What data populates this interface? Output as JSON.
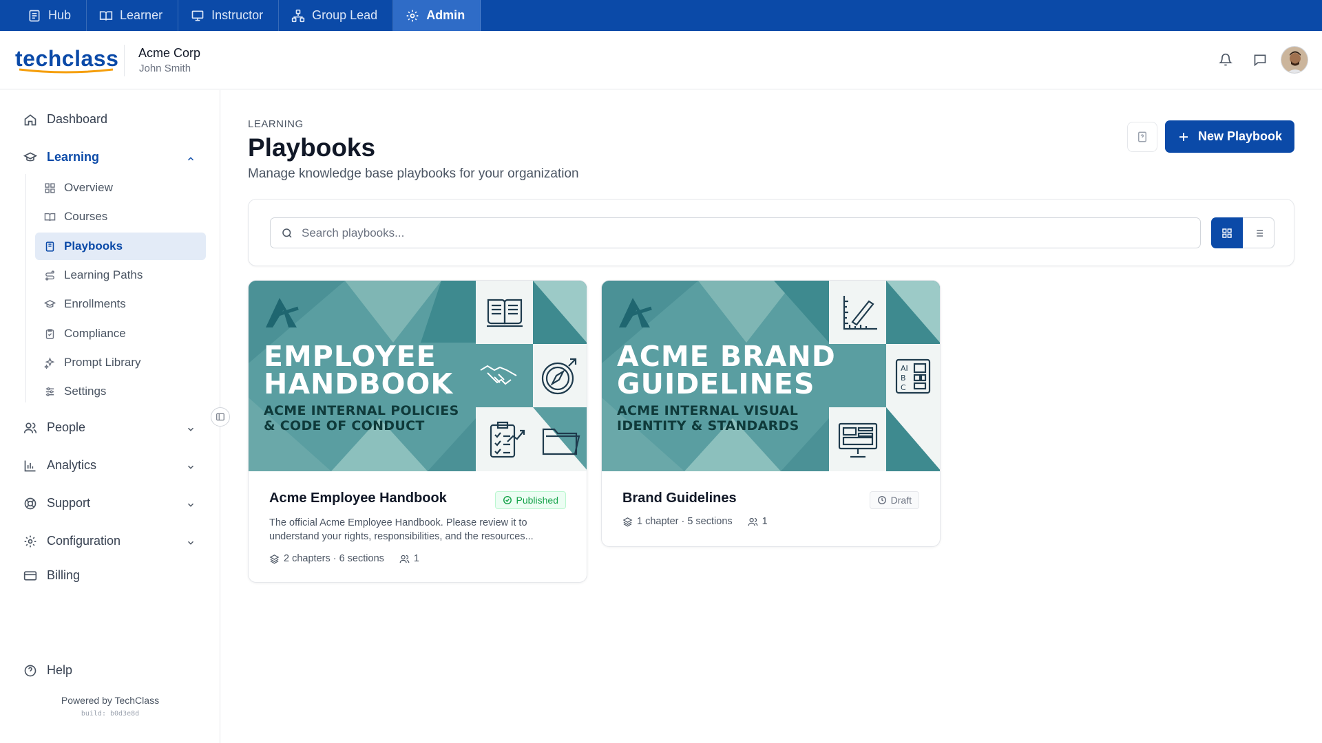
{
  "topnav": [
    {
      "label": "Hub",
      "icon": "hub-icon"
    },
    {
      "label": "Learner",
      "icon": "book-open-icon"
    },
    {
      "label": "Instructor",
      "icon": "presentation-icon"
    },
    {
      "label": "Group Lead",
      "icon": "network-icon"
    },
    {
      "label": "Admin",
      "icon": "gear-icon",
      "active": true
    }
  ],
  "header": {
    "logo": "techclass",
    "org": "Acme Corp",
    "user": "John Smith"
  },
  "sidebar": {
    "dashboard": "Dashboard",
    "learning": "Learning",
    "sub": [
      "Overview",
      "Courses",
      "Playbooks",
      "Learning Paths",
      "Enrollments",
      "Compliance",
      "Prompt Library",
      "Settings"
    ],
    "people": "People",
    "analytics": "Analytics",
    "support": "Support",
    "configuration": "Configuration",
    "billing": "Billing",
    "help": "Help",
    "powered": "Powered by TechClass",
    "build": "build: b0d3e8d"
  },
  "page": {
    "section": "LEARNING",
    "title": "Playbooks",
    "subtitle": "Manage knowledge base playbooks for your organization",
    "new_button": "New Playbook",
    "search_placeholder": "Search playbooks..."
  },
  "cards": [
    {
      "cover_title": "EMPLOYEE\nHANDBOOK",
      "cover_subtitle": "ACME INTERNAL POLICIES\n& CODE OF CONDUCT",
      "title": "Acme Employee Handbook",
      "status": "Published",
      "description": "The official Acme Employee Handbook. Please review it to understand your rights, responsibilities, and the resources...",
      "structure": "2 chapters · 6 sections",
      "members": "1"
    },
    {
      "cover_title": "ACME BRAND\nGUIDELINES",
      "cover_subtitle": "ACME INTERNAL VISUAL\nIDENTITY & STANDARDS",
      "title": "Brand Guidelines",
      "status": "Draft",
      "description": "",
      "structure": "1 chapter · 5 sections",
      "members": "1"
    }
  ],
  "colors": {
    "primary": "#0b4aa8",
    "teal": "#3e8a8f",
    "published": "#16a34a"
  }
}
